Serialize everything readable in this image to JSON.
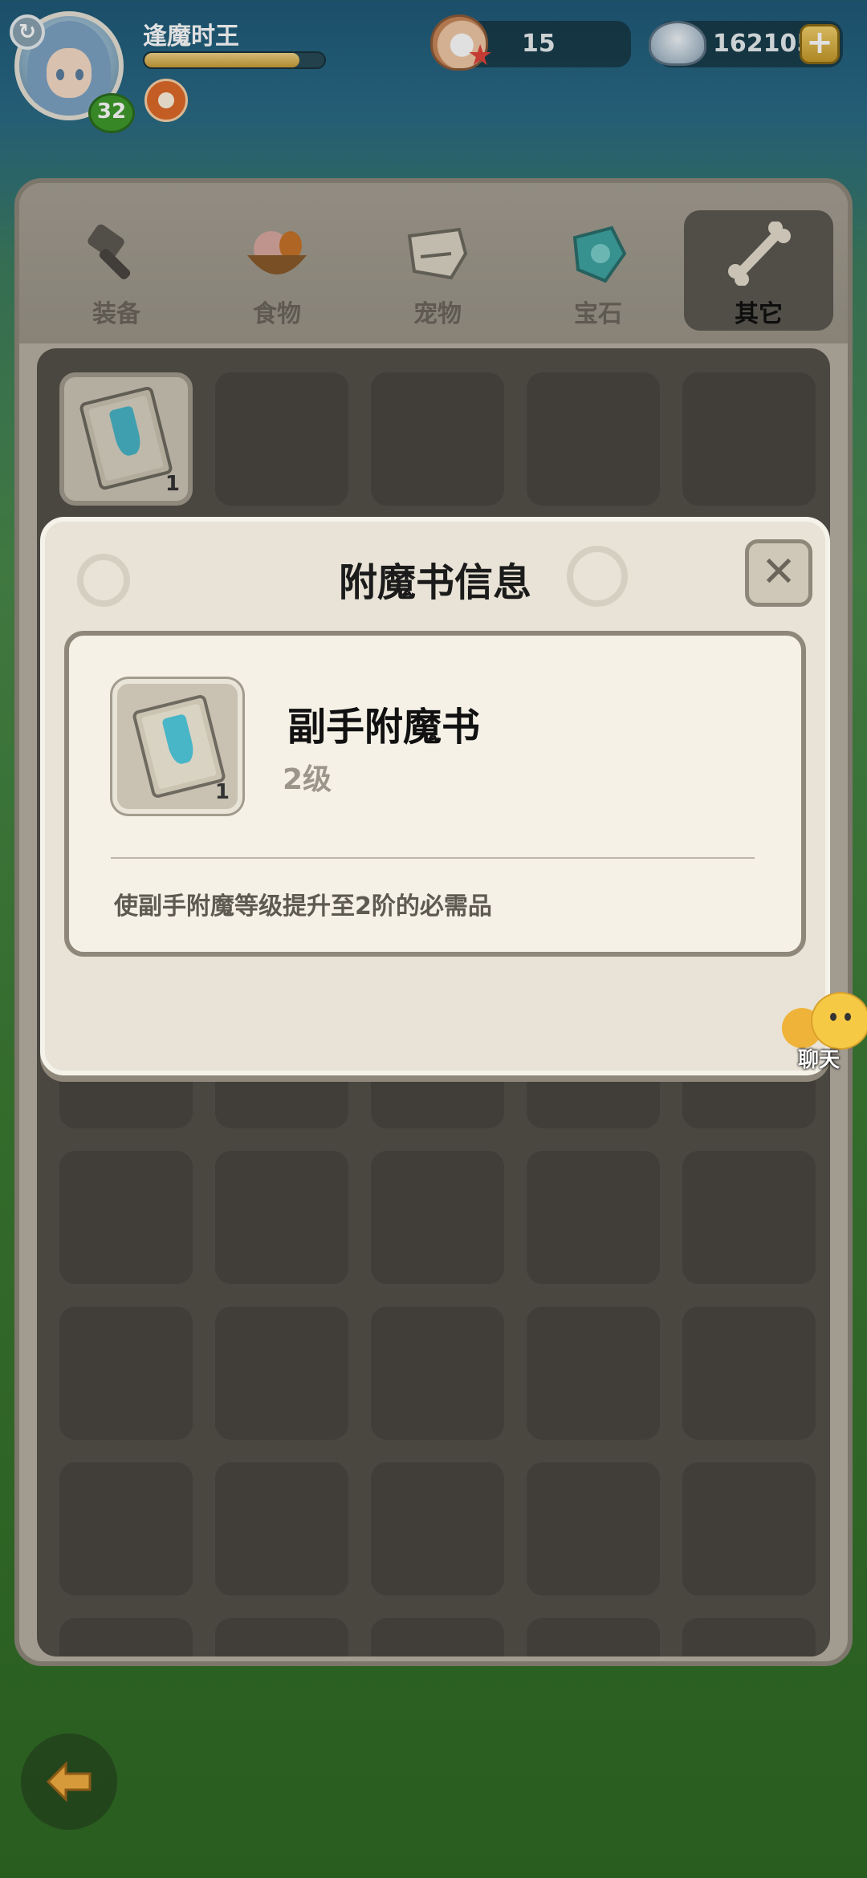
{
  "player": {
    "name": "逢魔时王",
    "level": "32",
    "xp_fraction": 0.86
  },
  "currency": {
    "shells": "15",
    "pearls": "162105"
  },
  "tabs": [
    {
      "label": "装备",
      "icon": "hammer-icon",
      "active": false
    },
    {
      "label": "食物",
      "icon": "food-bowl-icon",
      "active": false
    },
    {
      "label": "宠物",
      "icon": "dino-skull-icon",
      "active": false
    },
    {
      "label": "宝石",
      "icon": "gem-icon",
      "active": false
    },
    {
      "label": "其它",
      "icon": "bone-icon",
      "active": true
    }
  ],
  "inventory": {
    "first_item_qty": "1"
  },
  "dialog": {
    "title": "附魔书信息",
    "item_name": "副手附魔书",
    "item_level": "2级",
    "item_qty": "1",
    "description": "使副手附魔等级提升至2阶的必需品"
  },
  "chat": {
    "label": "聊天"
  },
  "colors": {
    "accent_teal": "#49b6c7",
    "panel_bg": "#b8b1a4",
    "slot_bg": "#4a4640",
    "level_badge": "#3f9a2d"
  }
}
